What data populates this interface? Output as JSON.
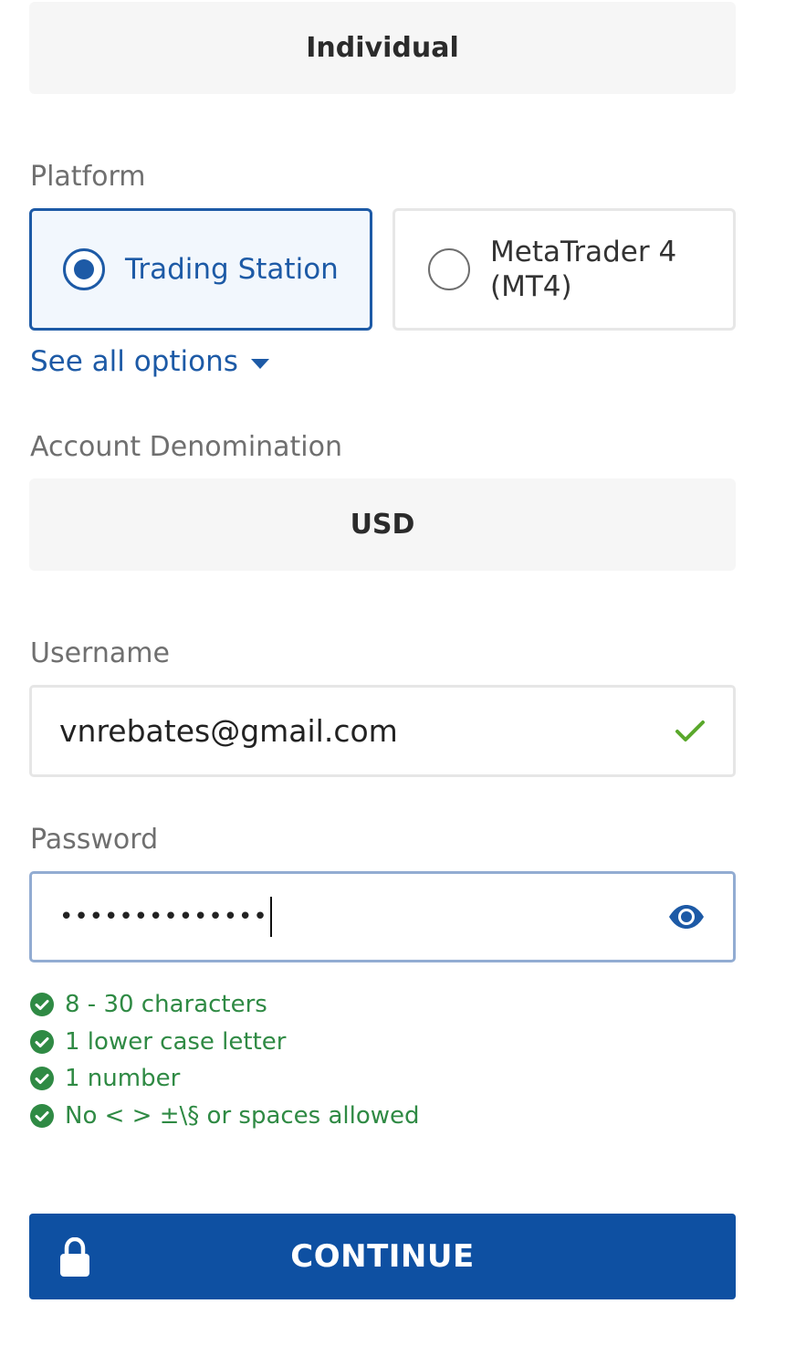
{
  "account_type": {
    "value": "Individual"
  },
  "platform": {
    "label": "Platform",
    "options": [
      {
        "label": "Trading Station",
        "selected": true
      },
      {
        "label_line1": "MetaTrader 4",
        "label_line2": "(MT4)",
        "selected": false
      }
    ],
    "see_all": "See all options"
  },
  "denomination": {
    "label": "Account Denomination",
    "value": "USD"
  },
  "username": {
    "label": "Username",
    "value": "vnrebates@gmail.com",
    "status_icon": "check-icon"
  },
  "password": {
    "label": "Password",
    "masked_value": "••••••••••••••",
    "toggle_icon": "eye-icon"
  },
  "password_rules": [
    {
      "text": "8 - 30 characters",
      "met": true
    },
    {
      "text": "1 lower case letter",
      "met": true
    },
    {
      "text": "1 number",
      "met": true
    },
    {
      "text": "No < > ±\\§ or spaces allowed",
      "met": true
    }
  ],
  "continue_button": {
    "label": "CONTINUE",
    "icon": "lock-icon"
  },
  "colors": {
    "primary": "#1d5aa6",
    "button": "#0e50a2",
    "success": "#2f8a44",
    "check": "#5aa82c",
    "muted_label": "#6f6f6f"
  }
}
